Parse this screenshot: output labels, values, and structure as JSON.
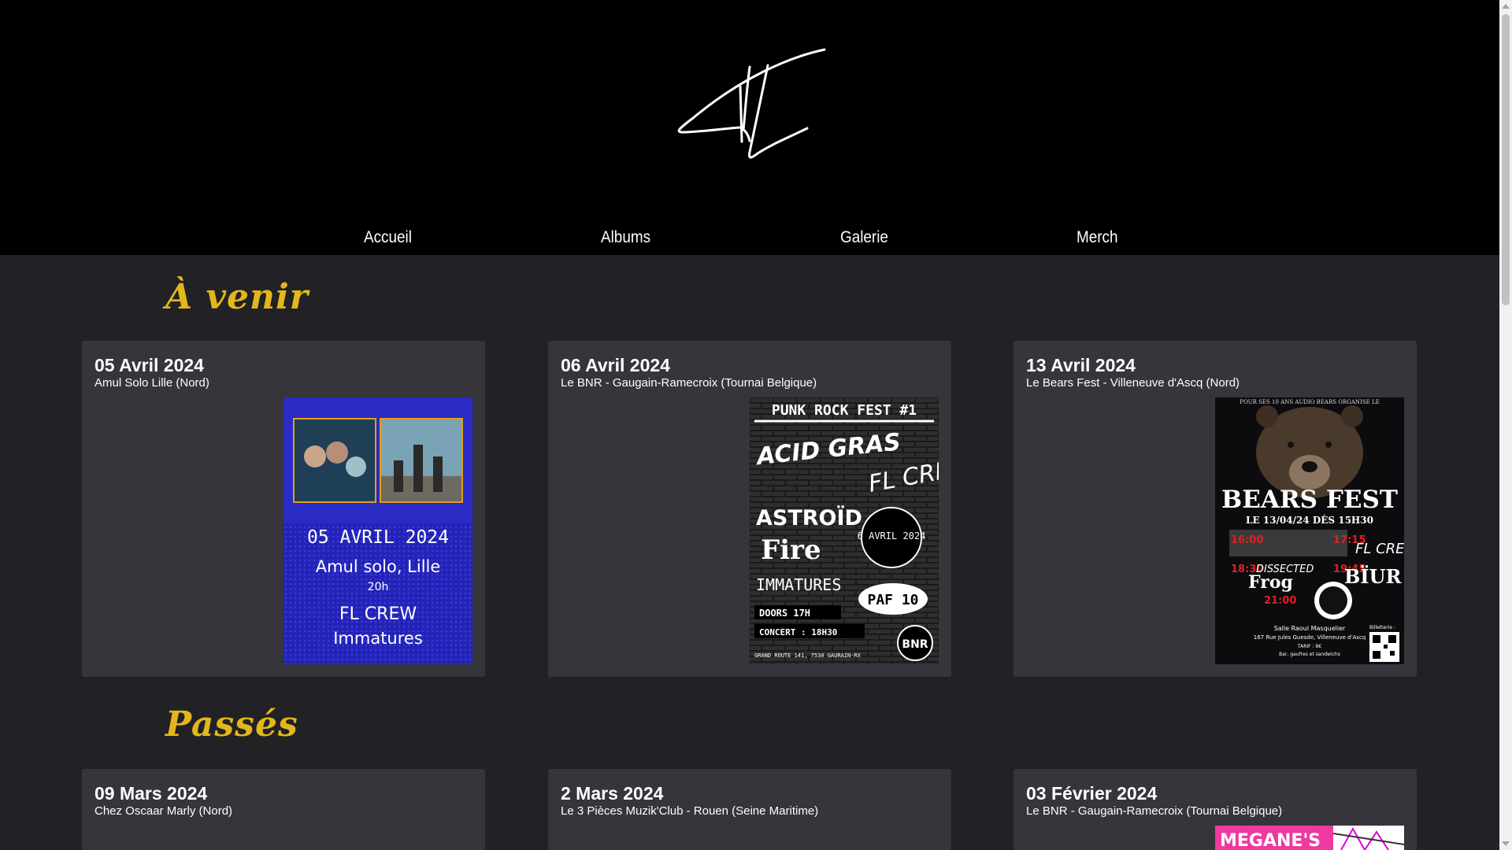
{
  "site": {
    "logo_text": "FL"
  },
  "nav": {
    "items": [
      "Accueil",
      "Albums",
      "Galerie",
      "Merch"
    ]
  },
  "upcoming": {
    "title": "À venir",
    "events": [
      {
        "date": "05 Avril 2024",
        "venue": "Amul Solo Lille (Nord)",
        "poster": {
          "lines": [
            "05 AVRIL 2024",
            "Amul solo, Lille",
            "20h",
            "FL CREW",
            "Immatures"
          ]
        }
      },
      {
        "date": "06 Avril 2024",
        "venue": "Le BNR - Gaugain-Ramecroix (Tournai Belgique)",
        "poster": {
          "lines": [
            "PUNK ROCK FEST #1",
            "ACID GRAS",
            "FL CREW",
            "ASTROÏD",
            "6 AVRIL 2024",
            "Fire",
            "IMMATURES",
            "PAF 10",
            "DOORS 17H",
            "CONCERT : 18H30",
            "GRAND ROUTE 141, 7530 GAURAIN-RX",
            "BNR"
          ]
        }
      },
      {
        "date": "13 Avril 2024",
        "venue": "Le Bears Fest - Villeneuve d'Ascq (Nord)",
        "poster": {
          "lines": [
            "POUR SES 10 ANS AUDIO BEARS ORGANISE LE",
            "BEARS FEST",
            "LE 13/04/24 DÈS 15H30",
            "16:00",
            "17:15",
            "FL CREW",
            "18:30",
            "19:45",
            "DISSECTED",
            "Frog",
            "BÏUR",
            "21:00",
            "Salle Raoul Masquelier",
            "167 Rue Jules Guesde, Villeneuve d'Ascq",
            "TARIF : 8€",
            "Bar, gaufres et sandwichs",
            "Billetterie :"
          ]
        }
      }
    ]
  },
  "past": {
    "title": "Passés",
    "events": [
      {
        "date": "09 Mars 2024",
        "venue": "Chez Oscaar Marly (Nord)"
      },
      {
        "date": "2 Mars 2024",
        "venue": "Le 3 Pièces Muzik'Club - Rouen (Seine Maritime)"
      },
      {
        "date": "03 Février 2024",
        "venue": "Le BNR - Gaugain-Ramecroix (Tournai Belgique)",
        "poster": {
          "lines": [
            "MEGANE'S"
          ]
        }
      }
    ]
  }
}
